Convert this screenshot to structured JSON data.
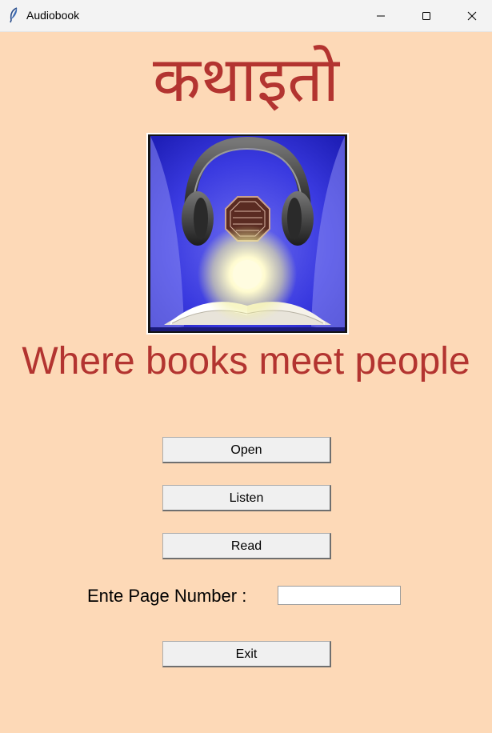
{
  "window": {
    "title": "Audiobook",
    "icon": "feather-icon"
  },
  "header": {
    "hindi_title": "कथाइतो",
    "tagline": "Where books meet people"
  },
  "logo": {
    "description_icon": "audiobook-logo-headphones-book-icon",
    "colors": {
      "background": "#3a3ae0",
      "book": "#e8e4da",
      "glow": "#fffbd0"
    }
  },
  "buttons": {
    "open": "Open",
    "listen": "Listen",
    "read": "Read",
    "exit": "Exit"
  },
  "page_entry": {
    "label": "Ente Page Number :",
    "value": ""
  },
  "colors": {
    "background": "#fdd9b7",
    "accent": "#b33430"
  }
}
